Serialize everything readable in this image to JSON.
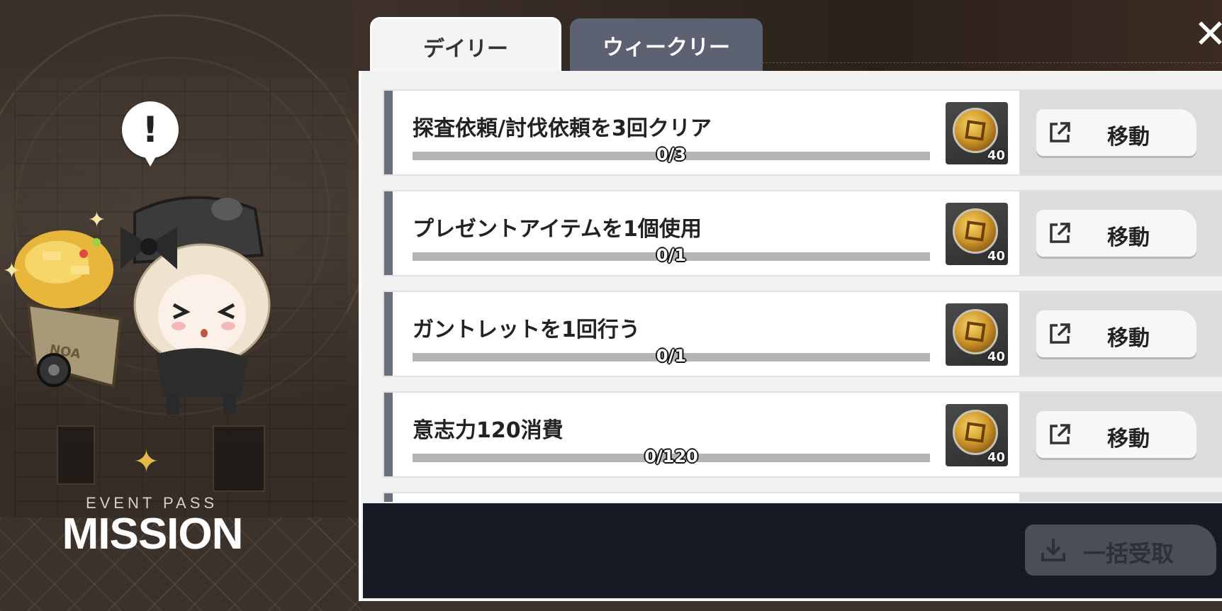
{
  "tabs": {
    "daily": "デイリー",
    "weekly": "ウィークリー"
  },
  "branding": {
    "subtitle": "EVENT PASS",
    "title": "MISSION",
    "cart_label": "NOA"
  },
  "missions": [
    {
      "title": "探査依頼/討伐依頼を3回クリア",
      "progress_text": "0/3",
      "progress": 0,
      "reward_qty": "40",
      "action": "移動"
    },
    {
      "title": "プレゼントアイテムを1個使用",
      "progress_text": "0/1",
      "progress": 0,
      "reward_qty": "40",
      "action": "移動"
    },
    {
      "title": "ガントレットを1回行う",
      "progress_text": "0/1",
      "progress": 0,
      "reward_qty": "40",
      "action": "移動"
    },
    {
      "title": "意志力120消費",
      "progress_text": "0/120",
      "progress": 0,
      "reward_qty": "40",
      "action": "移動"
    }
  ],
  "bottom": {
    "claim_all": "一括受取"
  },
  "icons": {
    "close": "close-icon",
    "go": "external-link-icon",
    "claim": "download-icon",
    "reward": "coin-icon",
    "alert": "exclamation-icon"
  },
  "colors": {
    "weekly_tab": "#5c6272",
    "row_accent": "#6a6f7e",
    "bottom_bar": "#171a24"
  }
}
